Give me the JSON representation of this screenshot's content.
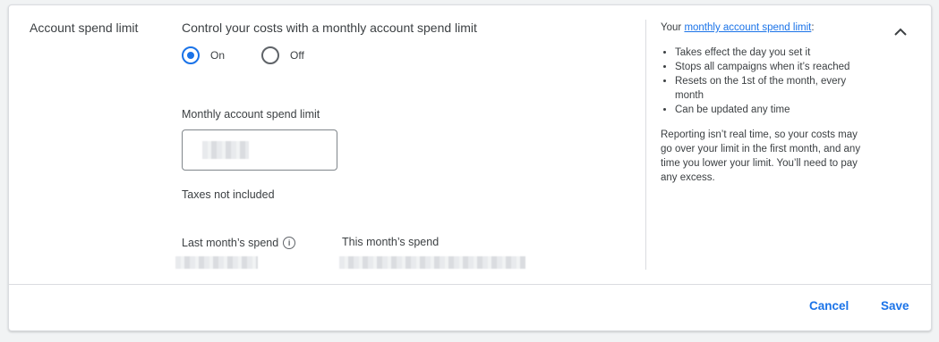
{
  "section": {
    "label": "Account spend limit"
  },
  "control": {
    "heading": "Control your costs with a monthly account spend limit",
    "options": [
      {
        "label": "On",
        "selected": true
      },
      {
        "label": "Off",
        "selected": false
      }
    ]
  },
  "limit_field": {
    "label": "Monthly account spend limit",
    "value": ""
  },
  "taxes_note": "Taxes not included",
  "spend": {
    "last_month_label": "Last month’s spend",
    "this_month_label": "This month’s spend",
    "info_icon": "info-icon"
  },
  "sidebar": {
    "intro_prefix": "Your ",
    "intro_link": "monthly account spend limit",
    "intro_suffix": ":",
    "bullets": [
      "Takes effect the day you set it",
      "Stops all campaigns when it’s reached",
      "Resets on the 1st of the month, every month",
      "Can be updated any time"
    ],
    "note": "Reporting isn’t real time, so your costs may go over your limit in the first month, and any time you lower your limit. You’ll need to pay any excess."
  },
  "collapse_icon": "chevron-up-icon",
  "actions": {
    "cancel": "Cancel",
    "save": "Save"
  },
  "colors": {
    "accent": "#1a73e8",
    "text": "#3c4043",
    "border": "#dadce0"
  }
}
